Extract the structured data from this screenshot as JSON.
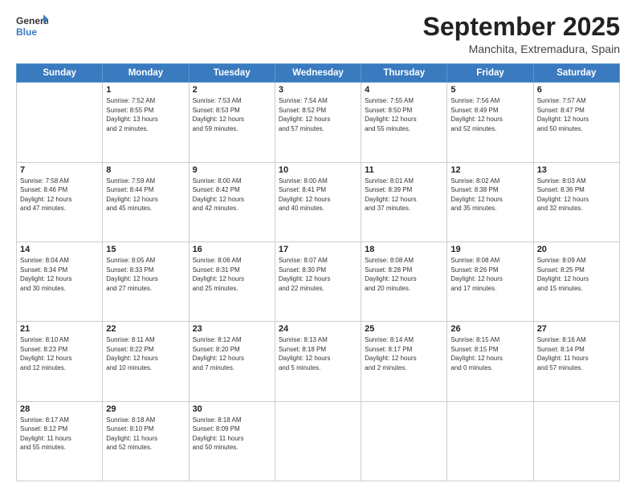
{
  "logo": {
    "line1": "General",
    "line2": "Blue"
  },
  "title": "September 2025",
  "subtitle": "Manchita, Extremadura, Spain",
  "weekdays": [
    "Sunday",
    "Monday",
    "Tuesday",
    "Wednesday",
    "Thursday",
    "Friday",
    "Saturday"
  ],
  "weeks": [
    [
      {
        "day": "",
        "info": ""
      },
      {
        "day": "1",
        "info": "Sunrise: 7:52 AM\nSunset: 8:55 PM\nDaylight: 13 hours\nand 2 minutes."
      },
      {
        "day": "2",
        "info": "Sunrise: 7:53 AM\nSunset: 8:53 PM\nDaylight: 12 hours\nand 59 minutes."
      },
      {
        "day": "3",
        "info": "Sunrise: 7:54 AM\nSunset: 8:52 PM\nDaylight: 12 hours\nand 57 minutes."
      },
      {
        "day": "4",
        "info": "Sunrise: 7:55 AM\nSunset: 8:50 PM\nDaylight: 12 hours\nand 55 minutes."
      },
      {
        "day": "5",
        "info": "Sunrise: 7:56 AM\nSunset: 8:49 PM\nDaylight: 12 hours\nand 52 minutes."
      },
      {
        "day": "6",
        "info": "Sunrise: 7:57 AM\nSunset: 8:47 PM\nDaylight: 12 hours\nand 50 minutes."
      }
    ],
    [
      {
        "day": "7",
        "info": "Sunrise: 7:58 AM\nSunset: 8:46 PM\nDaylight: 12 hours\nand 47 minutes."
      },
      {
        "day": "8",
        "info": "Sunrise: 7:59 AM\nSunset: 8:44 PM\nDaylight: 12 hours\nand 45 minutes."
      },
      {
        "day": "9",
        "info": "Sunrise: 8:00 AM\nSunset: 8:42 PM\nDaylight: 12 hours\nand 42 minutes."
      },
      {
        "day": "10",
        "info": "Sunrise: 8:00 AM\nSunset: 8:41 PM\nDaylight: 12 hours\nand 40 minutes."
      },
      {
        "day": "11",
        "info": "Sunrise: 8:01 AM\nSunset: 8:39 PM\nDaylight: 12 hours\nand 37 minutes."
      },
      {
        "day": "12",
        "info": "Sunrise: 8:02 AM\nSunset: 8:38 PM\nDaylight: 12 hours\nand 35 minutes."
      },
      {
        "day": "13",
        "info": "Sunrise: 8:03 AM\nSunset: 8:36 PM\nDaylight: 12 hours\nand 32 minutes."
      }
    ],
    [
      {
        "day": "14",
        "info": "Sunrise: 8:04 AM\nSunset: 8:34 PM\nDaylight: 12 hours\nand 30 minutes."
      },
      {
        "day": "15",
        "info": "Sunrise: 8:05 AM\nSunset: 8:33 PM\nDaylight: 12 hours\nand 27 minutes."
      },
      {
        "day": "16",
        "info": "Sunrise: 8:06 AM\nSunset: 8:31 PM\nDaylight: 12 hours\nand 25 minutes."
      },
      {
        "day": "17",
        "info": "Sunrise: 8:07 AM\nSunset: 8:30 PM\nDaylight: 12 hours\nand 22 minutes."
      },
      {
        "day": "18",
        "info": "Sunrise: 8:08 AM\nSunset: 8:28 PM\nDaylight: 12 hours\nand 20 minutes."
      },
      {
        "day": "19",
        "info": "Sunrise: 8:08 AM\nSunset: 8:26 PM\nDaylight: 12 hours\nand 17 minutes."
      },
      {
        "day": "20",
        "info": "Sunrise: 8:09 AM\nSunset: 8:25 PM\nDaylight: 12 hours\nand 15 minutes."
      }
    ],
    [
      {
        "day": "21",
        "info": "Sunrise: 8:10 AM\nSunset: 8:23 PM\nDaylight: 12 hours\nand 12 minutes."
      },
      {
        "day": "22",
        "info": "Sunrise: 8:11 AM\nSunset: 8:22 PM\nDaylight: 12 hours\nand 10 minutes."
      },
      {
        "day": "23",
        "info": "Sunrise: 8:12 AM\nSunset: 8:20 PM\nDaylight: 12 hours\nand 7 minutes."
      },
      {
        "day": "24",
        "info": "Sunrise: 8:13 AM\nSunset: 8:18 PM\nDaylight: 12 hours\nand 5 minutes."
      },
      {
        "day": "25",
        "info": "Sunrise: 8:14 AM\nSunset: 8:17 PM\nDaylight: 12 hours\nand 2 minutes."
      },
      {
        "day": "26",
        "info": "Sunrise: 8:15 AM\nSunset: 8:15 PM\nDaylight: 12 hours\nand 0 minutes."
      },
      {
        "day": "27",
        "info": "Sunrise: 8:16 AM\nSunset: 8:14 PM\nDaylight: 11 hours\nand 57 minutes."
      }
    ],
    [
      {
        "day": "28",
        "info": "Sunrise: 8:17 AM\nSunset: 8:12 PM\nDaylight: 11 hours\nand 55 minutes."
      },
      {
        "day": "29",
        "info": "Sunrise: 8:18 AM\nSunset: 8:10 PM\nDaylight: 11 hours\nand 52 minutes."
      },
      {
        "day": "30",
        "info": "Sunrise: 8:18 AM\nSunset: 8:09 PM\nDaylight: 11 hours\nand 50 minutes."
      },
      {
        "day": "",
        "info": ""
      },
      {
        "day": "",
        "info": ""
      },
      {
        "day": "",
        "info": ""
      },
      {
        "day": "",
        "info": ""
      }
    ]
  ]
}
